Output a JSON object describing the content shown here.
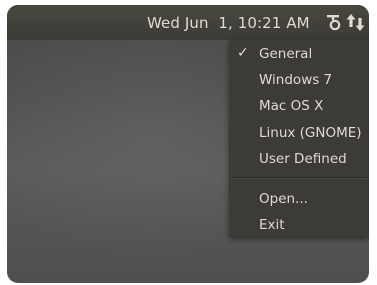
{
  "panel": {
    "clock": "Wed Jun  1, 10:21 AM",
    "keyboard_indicator_icon": "keyboard-layout-icon",
    "network_indicator_icon": "network-updown-icon"
  },
  "menu": {
    "items": [
      {
        "label": "General",
        "checked": true
      },
      {
        "label": "Windows 7",
        "checked": false
      },
      {
        "label": "Mac OS X",
        "checked": false
      },
      {
        "label": "Linux (GNOME)",
        "checked": false
      },
      {
        "label": "User Defined",
        "checked": false
      }
    ],
    "check_mark": "✓",
    "actions": [
      {
        "label": "Open..."
      },
      {
        "label": "Exit"
      }
    ]
  },
  "colors": {
    "panel_bg": "#3c3b37",
    "menu_bg": "#3c3b37",
    "text": "#dfdbd2",
    "desktop_bg": "#555555"
  }
}
